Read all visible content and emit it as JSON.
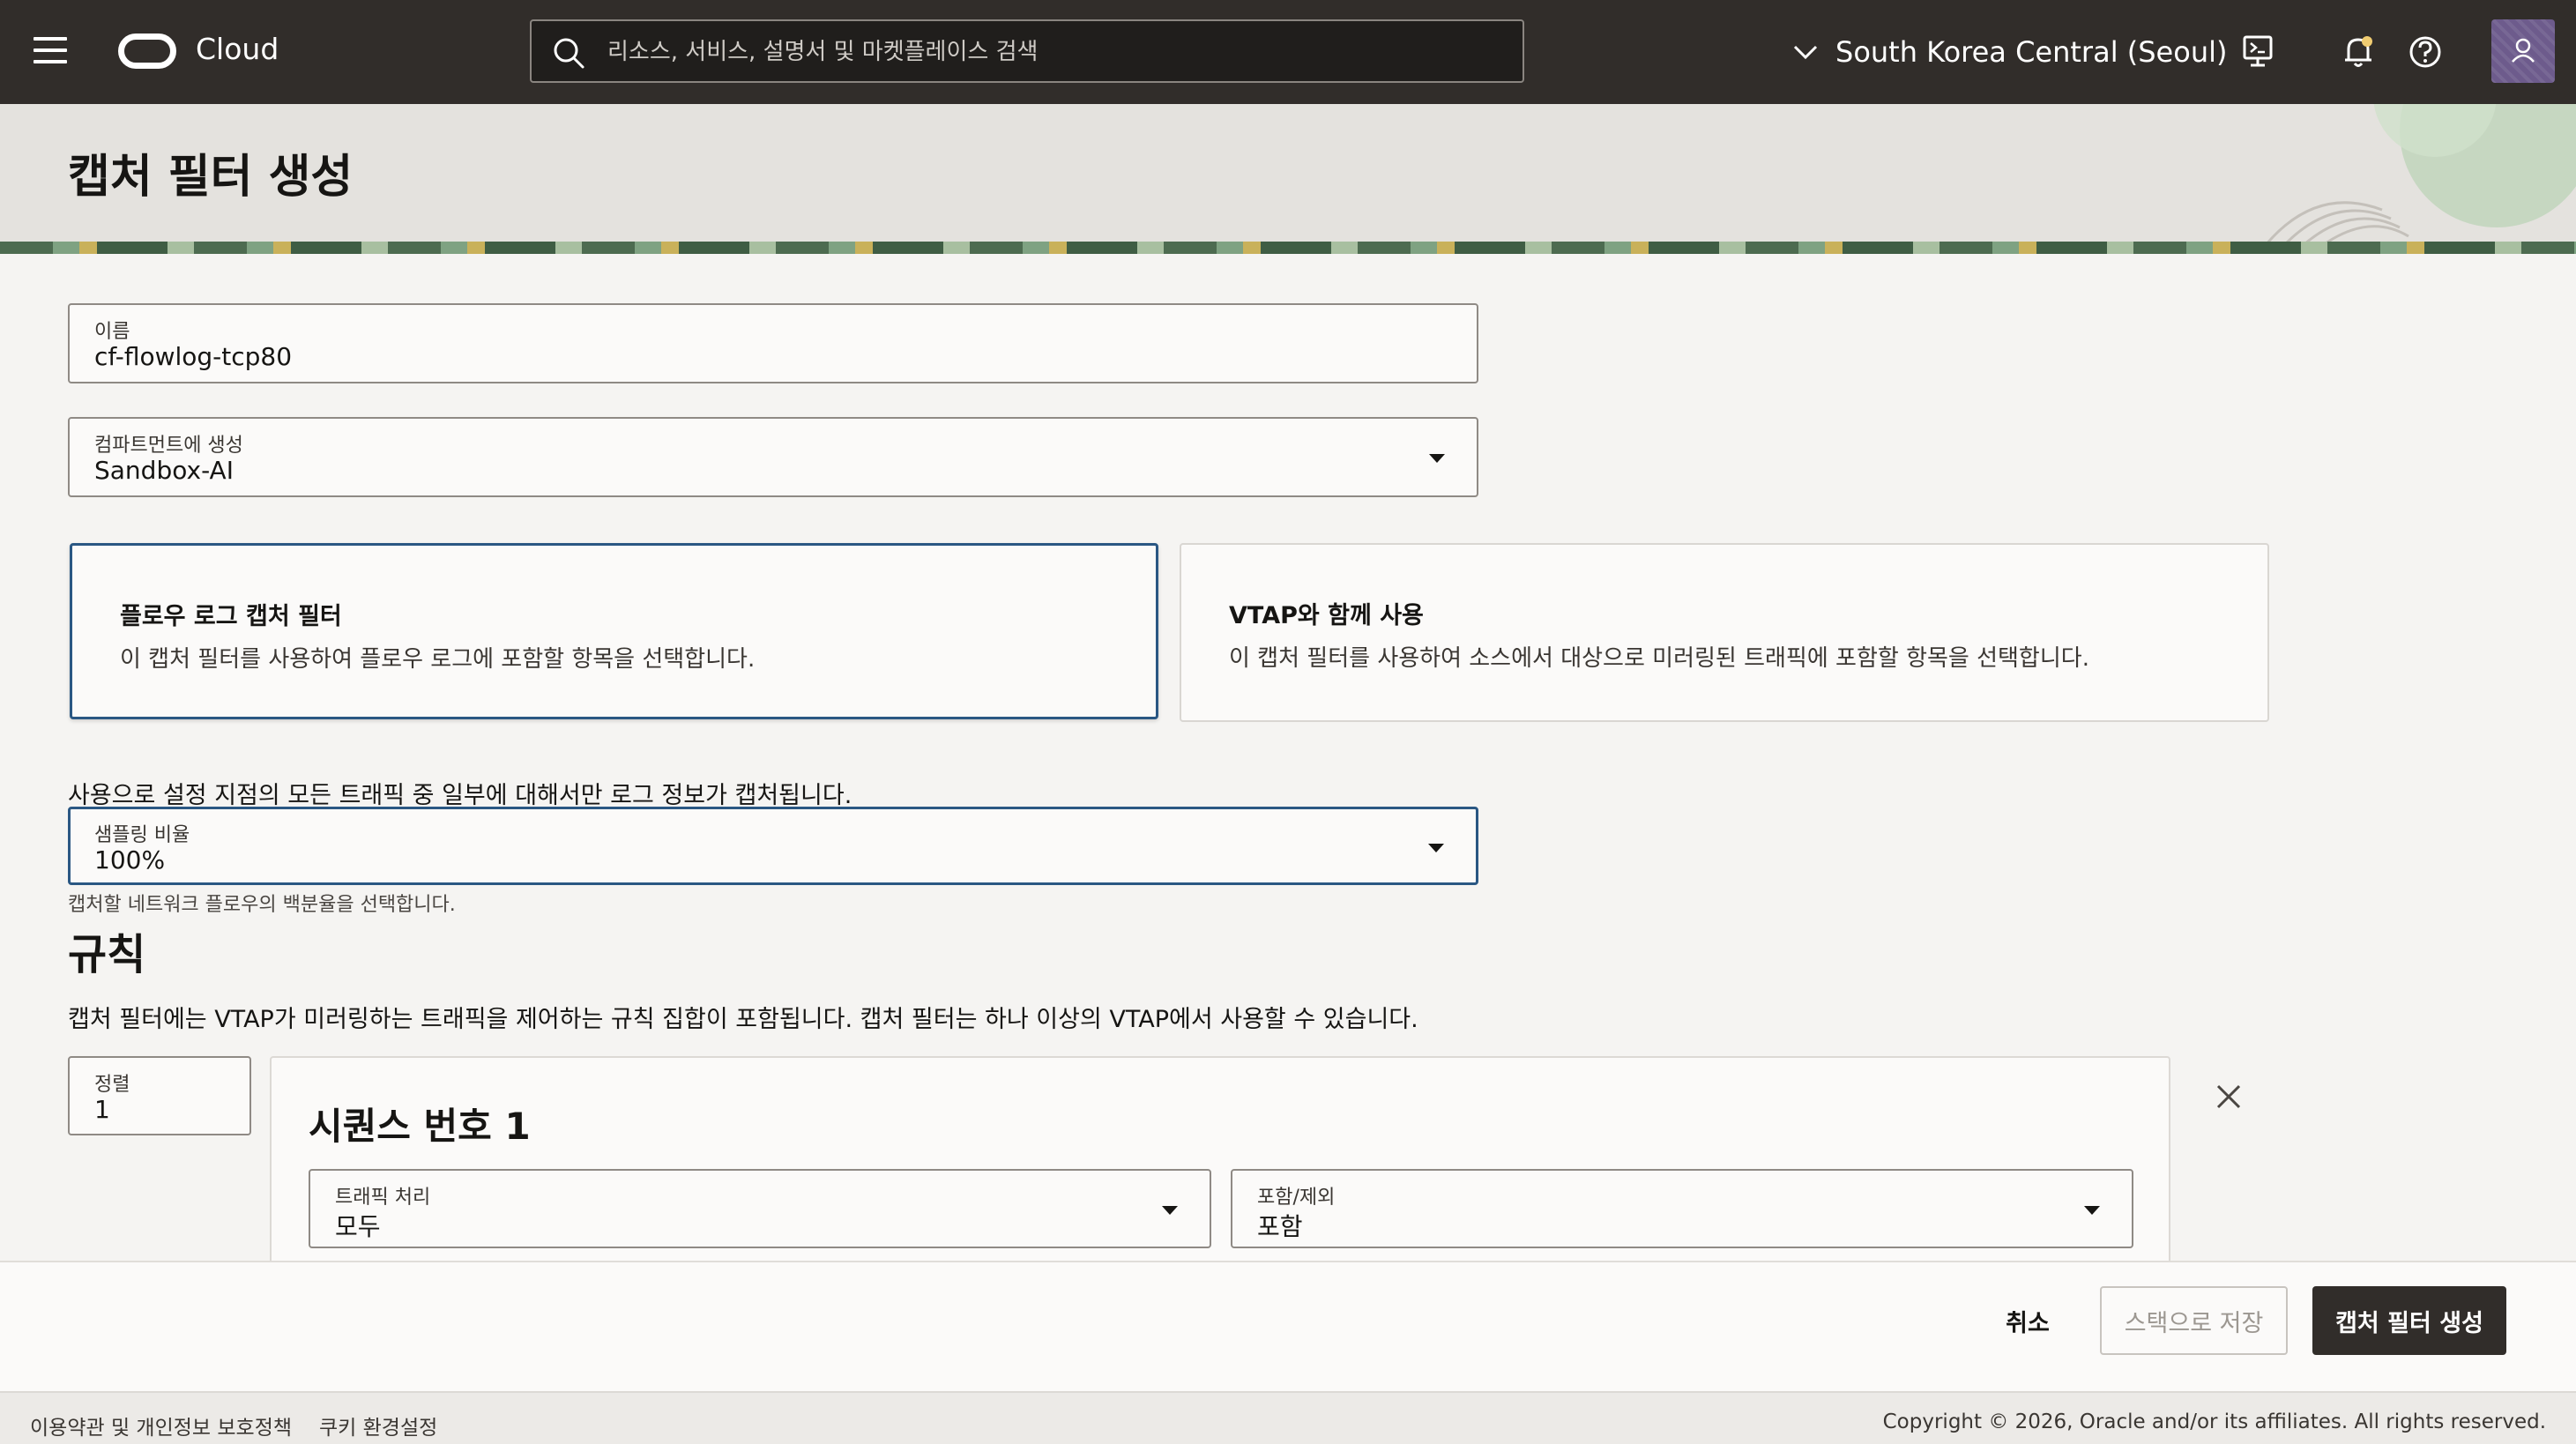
{
  "topbar": {
    "brand": "Cloud",
    "search_placeholder": "리소스, 서비스, 설명서 및 마켓플레이스 검색",
    "region": "South Korea Central (Seoul)"
  },
  "page": {
    "title": "캡처 필터 생성"
  },
  "form": {
    "name_label": "이름",
    "name_value": "cf-flowlog-tcp80",
    "compartment_label": "컴파트먼트에 생성",
    "compartment_value": "Sandbox-AI",
    "type_cards": [
      {
        "title": "플로우 로그 캡처 필터",
        "description": "이 캡처 필터를 사용하여 플로우 로그에 포함할 항목을 선택합니다.",
        "selected": true
      },
      {
        "title": "VTAP와 함께 사용",
        "description": "이 캡처 필터를 사용하여 소스에서 대상으로 미러링된 트래픽에 포함할 항목을 선택합니다.",
        "selected": false
      }
    ],
    "sampling_intro": "사용으로 설정 지점의 모든 트래픽 중 일부에 대해서만 로그 정보가 캡처됩니다.",
    "sampling_label": "샘플링 비율",
    "sampling_value": "100%",
    "sampling_help": "캡처할 네트워크 플로우의 백분율을 선택합니다."
  },
  "rules": {
    "heading": "규칙",
    "description": "캡처 필터에는 VTAP가 미러링하는 트래픽을 제어하는 규칙 집합이 포함됩니다. 캡처 필터는 하나 이상의 VTAP에서 사용할 수 있습니다.",
    "order_label": "정렬",
    "order_value": "1",
    "sequence_title": "시퀀스 번호 1",
    "traffic_label": "트래픽 처리",
    "traffic_value": "모두",
    "include_label": "포함/제외",
    "include_value": "포함"
  },
  "actions": {
    "cancel": "취소",
    "save_as_stack": "스택으로 저장",
    "create": "캡처 필터 생성"
  },
  "footer": {
    "terms": "이용약관 및 개인정보 보호정책",
    "cookies": "쿠키 환경설정",
    "copyright": "Copyright © 2026, Oracle and/or its affiliates. All rights reserved."
  },
  "colors": {
    "topbar_bg": "#312d2a",
    "focus_border": "#2a5783",
    "primary_button": "#312d2a"
  }
}
